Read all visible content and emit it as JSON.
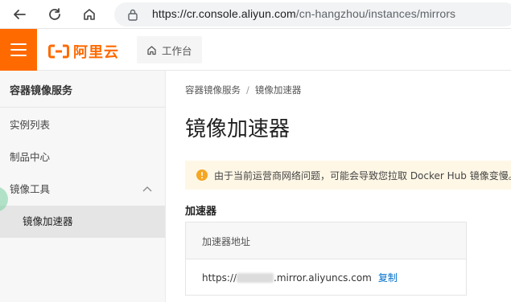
{
  "browser": {
    "url_host": "https://cr.console.aliyun.com",
    "url_path": "/cn-hangzhou/instances/mirrors"
  },
  "header": {
    "logo_text": "阿里云",
    "workbench_label": "工作台",
    "brand_color": "#ff6a00"
  },
  "sidebar": {
    "title": "容器镜像服务",
    "items": [
      {
        "label": "实例列表"
      },
      {
        "label": "制品中心"
      },
      {
        "label": "镜像工具",
        "expanded": true
      },
      {
        "label": "镜像加速器",
        "active": true
      }
    ]
  },
  "main": {
    "breadcrumb": [
      "容器镜像服务",
      "镜像加速器"
    ],
    "title": "镜像加速器",
    "notice": "由于当前运营商网络问题，可能会导致您拉取 Docker Hub 镜像变慢。",
    "section_title": "加速器",
    "table": {
      "header": "加速器地址",
      "address_prefix": "https://",
      "address_suffix": ".mirror.aliyuncs.com",
      "copy_label": "复制"
    }
  }
}
